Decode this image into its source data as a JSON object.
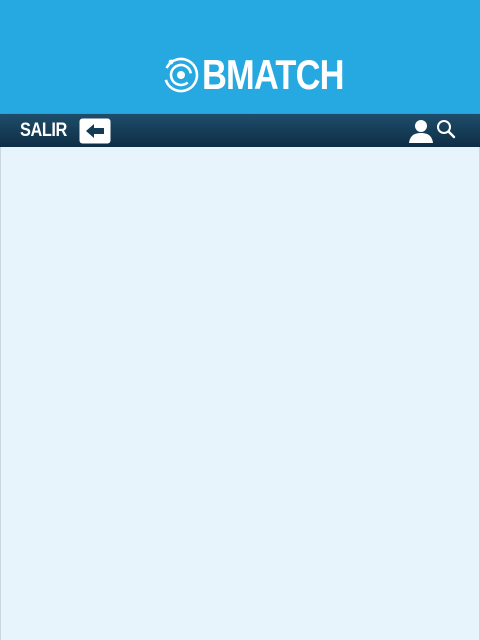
{
  "header": {
    "brand_name": "BMATCH",
    "logo_icon": "target-radar-icon",
    "background_color": "#26a8e1"
  },
  "navbar": {
    "exit_label": "SALIR",
    "exit_icon": "back-arrow-icon",
    "user_icon": "user-icon",
    "search_icon": "search-icon",
    "background_color": "#153a55"
  },
  "content": {
    "background_color": "#e8f4fc"
  }
}
